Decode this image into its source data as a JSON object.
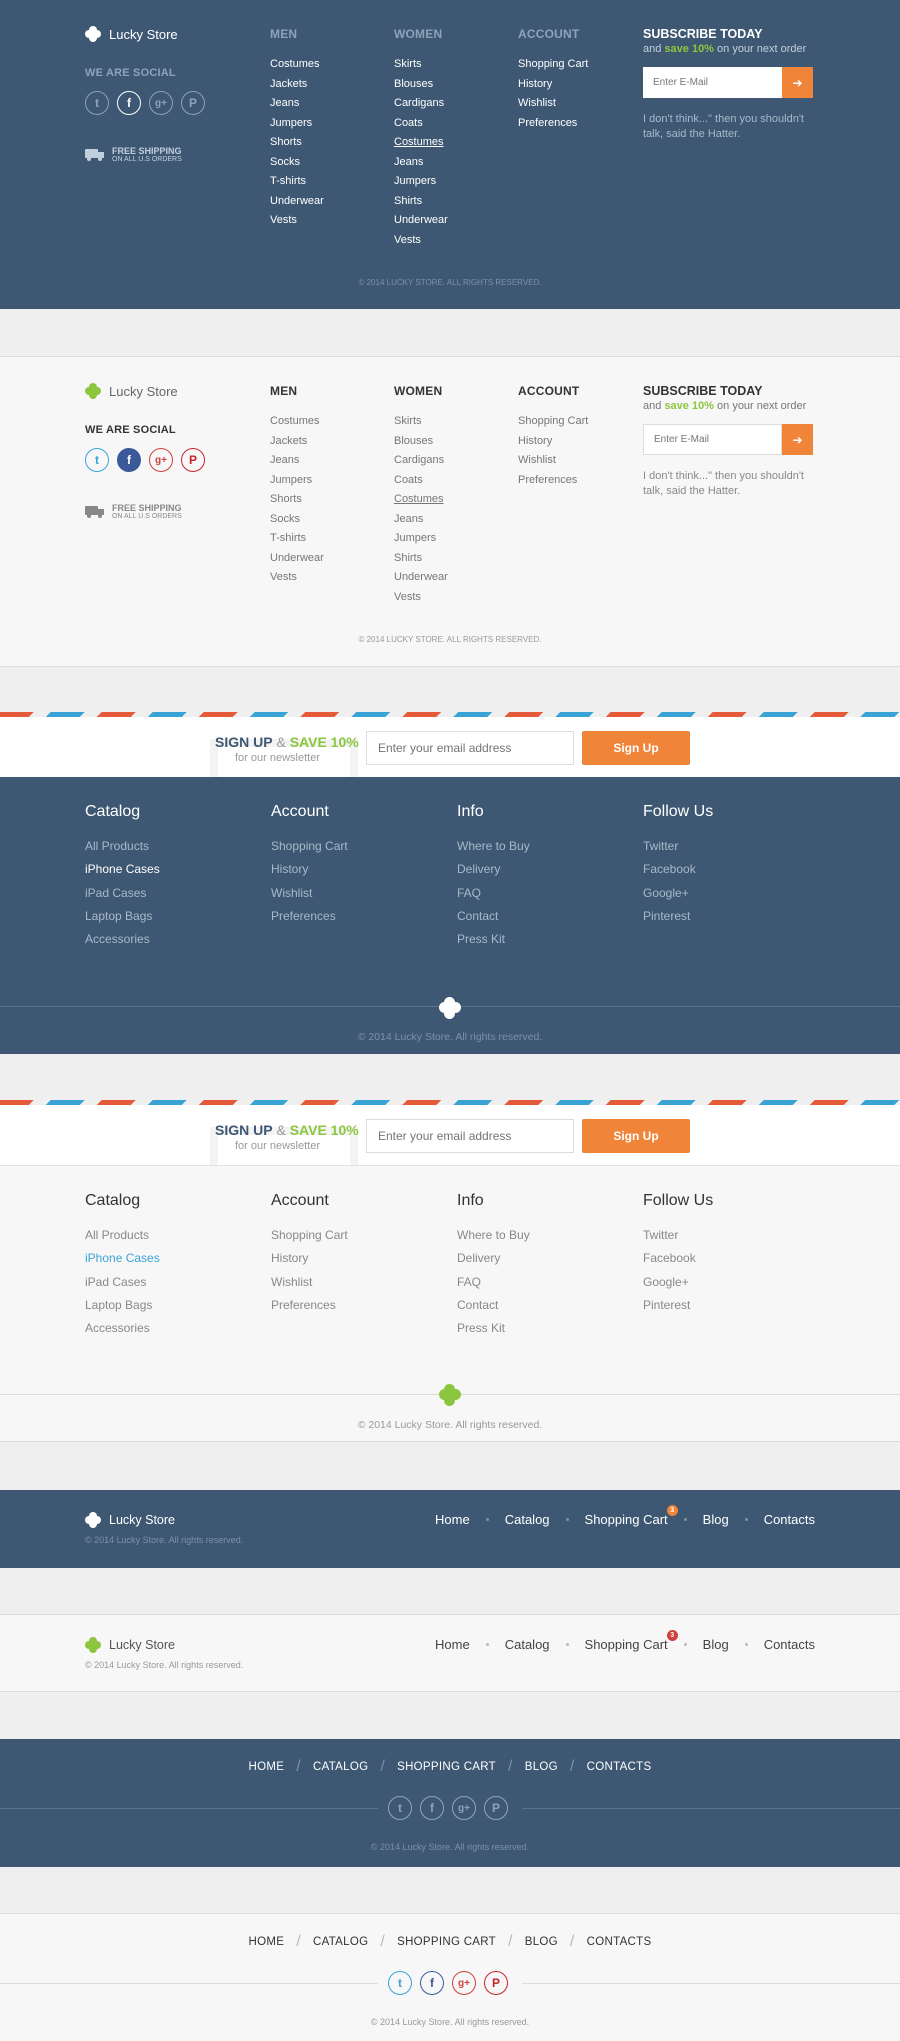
{
  "brand": "Lucky Store",
  "colors": {
    "dark": "#3e5873",
    "green": "#8cc63f",
    "orange": "#f0853a",
    "twitter": "#3aa3d6",
    "facebook": "#3b5998",
    "google": "#d0403c",
    "pinterest": "#c8232c",
    "link_blue": "#3aa3d6"
  },
  "footer1": {
    "social_heading": "WE ARE SOCIAL",
    "social_icons": [
      "twitter-icon",
      "facebook-icon",
      "google-plus-icon",
      "pinterest-icon"
    ],
    "shipping": {
      "title": "FREE SHIPPING",
      "subtitle": "ON ALL U.S ORDERS"
    },
    "men": {
      "heading": "MEN",
      "items": [
        "Costumes",
        "Jackets",
        "Jeans",
        "Jumpers",
        "Shorts",
        "Socks",
        "T-shirts",
        "Underwear",
        "Vests"
      ]
    },
    "women": {
      "heading": "WOMEN",
      "items": [
        "Skirts",
        "Blouses",
        "Cardigans",
        "Coats",
        "Costumes",
        "Jeans",
        "Jumpers",
        "Shirts",
        "Underwear",
        "Vests"
      ]
    },
    "account": {
      "heading": "ACCOUNT",
      "items": [
        "Shopping Cart",
        "History",
        "Wishlist",
        "Preferences"
      ]
    },
    "subscribe": {
      "heading": "SUBSCRIBE TODAY",
      "pre": "and ",
      "save": "save 10%",
      "post": " on your next order",
      "placeholder": "Enter E-Mail",
      "quote": "I don't think...\" then you shouldn't talk, said the Hatter."
    },
    "copyright": "© 2014 LUCKY STORE. ALL RIGHTS RESERVED."
  },
  "footer3": {
    "newsletter": {
      "sign_up": "SIGN UP",
      "amp": " & ",
      "save": "SAVE 10%",
      "sub": "for our newsletter",
      "placeholder": "Enter your email address",
      "button": "Sign Up"
    },
    "catalog": {
      "heading": "Catalog",
      "items": [
        "All Products",
        "iPhone Cases",
        "iPad Cases",
        "Laptop Bags",
        "Accessories"
      ]
    },
    "account": {
      "heading": "Account",
      "items": [
        "Shopping Cart",
        "History",
        "Wishlist",
        "Preferences"
      ]
    },
    "info": {
      "heading": "Info",
      "items": [
        "Where to Buy",
        "Delivery",
        "FAQ",
        "Contact",
        "Press Kit"
      ]
    },
    "follow": {
      "heading": "Follow Us",
      "items": [
        "Twitter",
        "Facebook",
        "Google+",
        "Pinterest"
      ]
    },
    "copyright": "© 2014 Lucky Store. All rights reserved."
  },
  "footer5": {
    "copyright": "© 2014 Lucky Store. All rights reserved.",
    "nav": [
      "Home",
      "Catalog",
      "Shopping Cart",
      "Blog",
      "Contacts"
    ],
    "cart_badge": "3"
  },
  "footer7": {
    "nav": [
      "HOME",
      "CATALOG",
      "SHOPPING CART",
      "BLOG",
      "CONTACTS"
    ],
    "social_icons": [
      "twitter-icon",
      "facebook-icon",
      "google-plus-icon",
      "pinterest-icon"
    ],
    "copyright": "© 2014 Lucky Store. All rights reserved."
  }
}
